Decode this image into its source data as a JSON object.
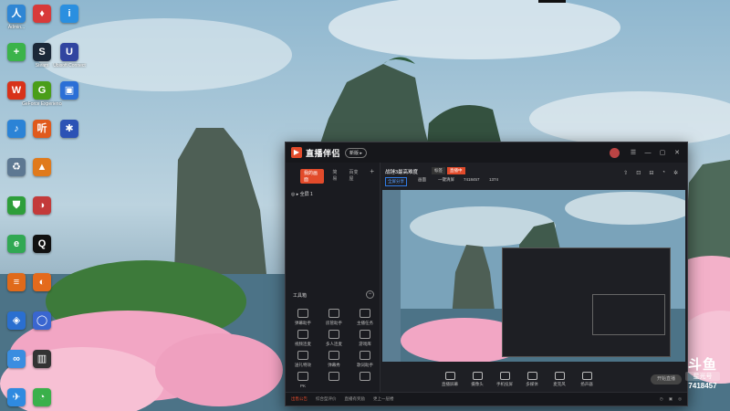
{
  "desktop": {
    "icons": [
      {
        "label": "Admin...",
        "glyph": "人",
        "color": "#2f86d4"
      },
      {
        "label": "",
        "glyph": "♦",
        "color": "#d83a3a"
      },
      {
        "label": "",
        "glyph": "i",
        "color": "#2a8fe0"
      },
      {
        "label": "",
        "glyph": "+",
        "color": "#3bb34a"
      },
      {
        "label": "Steam",
        "glyph": "S",
        "color": "#1b2838"
      },
      {
        "label": "Ubisoft Connect",
        "glyph": "U",
        "color": "#3145a0"
      },
      {
        "label": "",
        "glyph": "W",
        "color": "#d8321a"
      },
      {
        "label": "GeForce Experience",
        "glyph": "G",
        "color": "#4a9e19"
      },
      {
        "label": "",
        "glyph": "▣",
        "color": "#2b6fd6"
      },
      {
        "label": "",
        "glyph": "♪",
        "color": "#2b83d6"
      },
      {
        "label": "",
        "glyph": "听",
        "color": "#e05a1c"
      },
      {
        "label": "",
        "glyph": "✱",
        "color": "#2c52b5"
      },
      {
        "label": "",
        "glyph": "♻",
        "color": "#5d7892"
      },
      {
        "label": "",
        "glyph": "▲",
        "color": "#e07a1c"
      },
      {
        "label": "",
        "glyph": "⛊",
        "color": "#2e9e3a"
      },
      {
        "label": "",
        "glyph": "◑",
        "color": "#c33a3a"
      },
      {
        "label": "",
        "glyph": "e",
        "color": "#31a853"
      },
      {
        "label": "",
        "glyph": "Q",
        "color": "#111111"
      },
      {
        "label": "",
        "glyph": "≡",
        "color": "#e06a1a"
      },
      {
        "label": "",
        "glyph": "◐",
        "color": "#e46a1c"
      },
      {
        "label": "",
        "glyph": "◈",
        "color": "#2a6fd0"
      },
      {
        "label": "",
        "glyph": "◯",
        "color": "#3a66d0"
      },
      {
        "label": "",
        "glyph": "∞",
        "color": "#3a8de0"
      },
      {
        "label": "",
        "glyph": "▥",
        "color": "#333333"
      },
      {
        "label": "",
        "glyph": "✈",
        "color": "#2f8ae0"
      },
      {
        "label": "",
        "glyph": "◔",
        "color": "#3ab04a"
      }
    ]
  },
  "app": {
    "title": "直播伴侣",
    "version": "新版 ▸",
    "left_tabs": [
      "我的画面",
      "简易",
      "百变屋",
      "+"
    ],
    "scene_label": "◎ ▸ 全屏 1",
    "tools_title": "工具箱",
    "tools": [
      {
        "label": "弹幕助手",
        "icon": "chat-icon"
      },
      {
        "label": "房管助手",
        "icon": "admin-icon"
      },
      {
        "label": "主播任务",
        "icon": "task-icon"
      },
      {
        "label": "视频连麦",
        "icon": "video-call-icon"
      },
      {
        "label": "多人连麦",
        "icon": "multi-call-icon"
      },
      {
        "label": "游戏库",
        "icon": "game-icon"
      },
      {
        "label": "送礼特效",
        "icon": "gift-icon"
      },
      {
        "label": "弹幕秀",
        "icon": "danmaku-icon"
      },
      {
        "label": "歌词助手",
        "icon": "lyrics-icon"
      },
      {
        "label": "PK",
        "icon": "pk-icon"
      },
      {
        "label": "",
        "icon": "download-icon"
      },
      {
        "label": "",
        "icon": "warning-icon"
      }
    ],
    "room": {
      "title": "战锤3最高难度",
      "badge": "标签",
      "live": "直播中",
      "chips": [
        "全屏分享",
        "画面",
        "一键清屏",
        "7418457",
        "1374"
      ]
    },
    "controls": [
      {
        "label": "直播屏幕",
        "icon": "screen-icon"
      },
      {
        "label": "摄像头",
        "icon": "camera-icon"
      },
      {
        "label": "手机投屏",
        "icon": "phone-icon"
      },
      {
        "label": "多媒体",
        "icon": "media-icon"
      },
      {
        "label": "麦克风",
        "icon": "mic-icon"
      },
      {
        "label": "扬声器",
        "icon": "speaker-icon"
      }
    ],
    "go_live": "开始直播",
    "status": {
      "items": [
        "出售公告",
        "综合型评价",
        "直播有奖励",
        "更上一层楼"
      ],
      "right": [
        "◷",
        "▣",
        "◎"
      ]
    }
  },
  "watermark": {
    "brand": "斗鱼",
    "sub": "星光号",
    "room": "7418457"
  }
}
